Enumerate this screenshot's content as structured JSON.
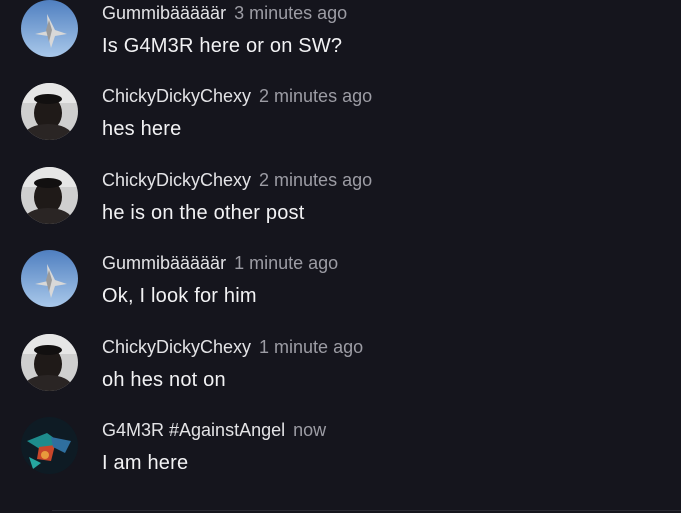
{
  "colors": {
    "background": "#15151d",
    "author": "#e3e3e6",
    "time": "#9c9ca4",
    "text": "#f2f2f4"
  },
  "messages": [
    {
      "author": "Gummibääääär",
      "time": "3 minutes ago",
      "text": "Is G4M3R here or on SW?",
      "avatar": "jet-sky-avatar"
    },
    {
      "author": "ChickyDickyChexy",
      "time": "2 minutes ago",
      "text": "hes here",
      "avatar": "person-avatar"
    },
    {
      "author": "ChickyDickyChexy",
      "time": "2 minutes ago",
      "text": "he is on the other post",
      "avatar": "person-avatar"
    },
    {
      "author": "Gummibääääär",
      "time": "1 minute ago",
      "text": "Ok, I look for him",
      "avatar": "jet-sky-avatar"
    },
    {
      "author": "ChickyDickyChexy",
      "time": "1 minute ago",
      "text": "oh hes not on",
      "avatar": "person-avatar"
    },
    {
      "author": "G4M3R #AgainstAngel",
      "time": "now",
      "text": "I am here",
      "avatar": "neon-graphic-avatar"
    }
  ]
}
